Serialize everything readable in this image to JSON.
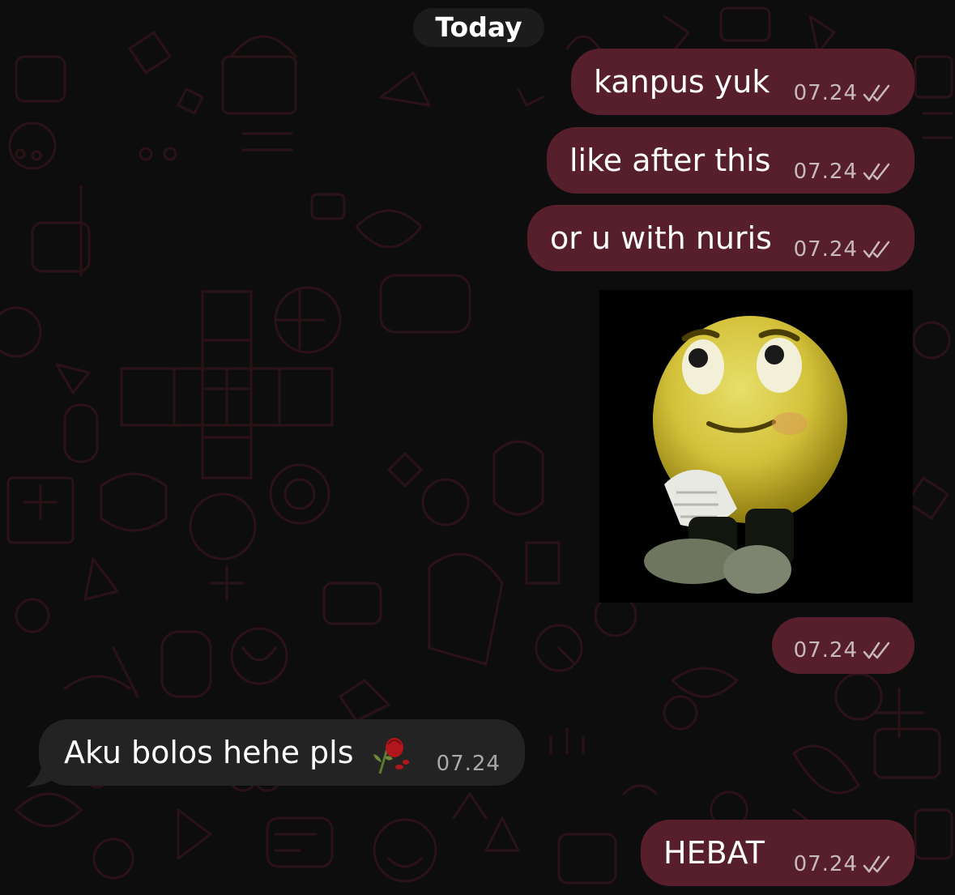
{
  "chat": {
    "date_separator": "Today",
    "theme": {
      "background": "#0e0d0d",
      "outgoing_bubble": "#571f2c",
      "incoming_bubble": "#232323",
      "wallpaper_doodle": "#2a1217"
    },
    "messages": [
      {
        "direction": "outgoing",
        "text": "kanpus yuk",
        "time": "07.24",
        "status": "read-double-check-icon"
      },
      {
        "direction": "outgoing",
        "text": "like after this",
        "time": "07.24",
        "status": "read-double-check-icon"
      },
      {
        "direction": "outgoing",
        "text": "or u with nuris",
        "time": "07.24",
        "status": "read-double-check-icon"
      },
      {
        "direction": "outgoing",
        "type": "image",
        "image": "confused-emoji-sticker-image",
        "time": "07.24",
        "status": "read-double-check-icon"
      },
      {
        "direction": "incoming",
        "text": "Aku bolos hehe pls",
        "emoji": "wilted-flower-emoji",
        "time": "07.24"
      },
      {
        "direction": "outgoing",
        "text": "HEBAT",
        "time": "07.24",
        "status": "read-double-check-icon"
      }
    ]
  }
}
